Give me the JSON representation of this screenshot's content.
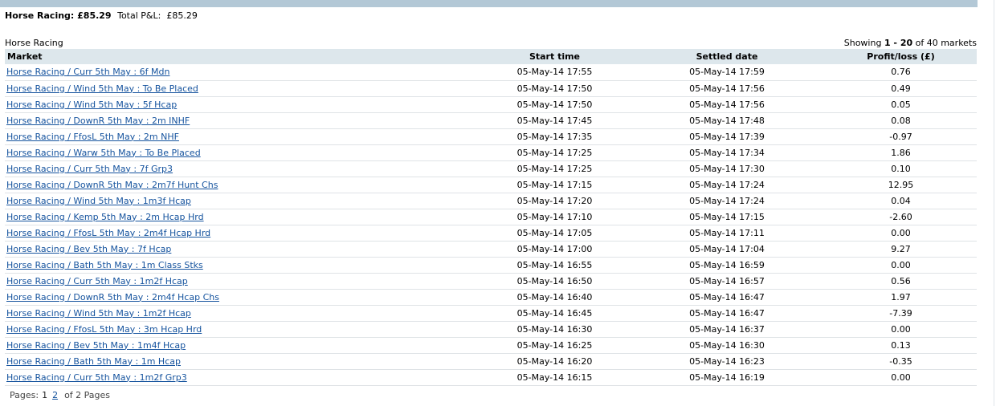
{
  "summary": {
    "category_total": "Horse Racing: £85.29",
    "total_label": "Total P&L:",
    "total_value": "£85.29"
  },
  "section_title": "Horse Racing",
  "showing": {
    "prefix": "Showing",
    "range": "1 - 20",
    "suffix": "of 40 markets"
  },
  "table": {
    "headers": {
      "market": "Market",
      "start": "Start time",
      "settled": "Settled date",
      "pl": "Profit/loss (£)"
    },
    "rows": [
      {
        "market": "Horse Racing / Curr 5th May : 6f Mdn",
        "start": "05-May-14 17:55",
        "settled": "05-May-14 17:59",
        "pl": "0.76"
      },
      {
        "market": "Horse Racing / Wind 5th May : To Be Placed",
        "start": "05-May-14 17:50",
        "settled": "05-May-14 17:56",
        "pl": "0.49"
      },
      {
        "market": "Horse Racing / Wind 5th May : 5f Hcap",
        "start": "05-May-14 17:50",
        "settled": "05-May-14 17:56",
        "pl": "0.05"
      },
      {
        "market": "Horse Racing / DownR 5th May : 2m INHF",
        "start": "05-May-14 17:45",
        "settled": "05-May-14 17:48",
        "pl": "0.08"
      },
      {
        "market": "Horse Racing / FfosL 5th May : 2m NHF",
        "start": "05-May-14 17:35",
        "settled": "05-May-14 17:39",
        "pl": "-0.97"
      },
      {
        "market": "Horse Racing / Warw 5th May : To Be Placed",
        "start": "05-May-14 17:25",
        "settled": "05-May-14 17:34",
        "pl": "1.86"
      },
      {
        "market": "Horse Racing / Curr 5th May : 7f Grp3",
        "start": "05-May-14 17:25",
        "settled": "05-May-14 17:30",
        "pl": "0.10"
      },
      {
        "market": "Horse Racing / DownR 5th May : 2m7f Hunt Chs",
        "start": "05-May-14 17:15",
        "settled": "05-May-14 17:24",
        "pl": "12.95"
      },
      {
        "market": "Horse Racing / Wind 5th May : 1m3f Hcap",
        "start": "05-May-14 17:20",
        "settled": "05-May-14 17:24",
        "pl": "0.04"
      },
      {
        "market": "Horse Racing / Kemp 5th May : 2m Hcap Hrd",
        "start": "05-May-14 17:10",
        "settled": "05-May-14 17:15",
        "pl": "-2.60"
      },
      {
        "market": "Horse Racing / FfosL 5th May : 2m4f Hcap Hrd",
        "start": "05-May-14 17:05",
        "settled": "05-May-14 17:11",
        "pl": "0.00"
      },
      {
        "market": "Horse Racing / Bev 5th May : 7f Hcap",
        "start": "05-May-14 17:00",
        "settled": "05-May-14 17:04",
        "pl": "9.27"
      },
      {
        "market": "Horse Racing / Bath 5th May : 1m Class Stks",
        "start": "05-May-14 16:55",
        "settled": "05-May-14 16:59",
        "pl": "0.00"
      },
      {
        "market": "Horse Racing / Curr 5th May : 1m2f Hcap",
        "start": "05-May-14 16:50",
        "settled": "05-May-14 16:57",
        "pl": "0.56"
      },
      {
        "market": "Horse Racing / DownR 5th May : 2m4f Hcap Chs",
        "start": "05-May-14 16:40",
        "settled": "05-May-14 16:47",
        "pl": "1.97"
      },
      {
        "market": "Horse Racing / Wind 5th May : 1m2f Hcap",
        "start": "05-May-14 16:45",
        "settled": "05-May-14 16:47",
        "pl": "-7.39"
      },
      {
        "market": "Horse Racing / FfosL 5th May : 3m Hcap Hrd",
        "start": "05-May-14 16:30",
        "settled": "05-May-14 16:37",
        "pl": "0.00"
      },
      {
        "market": "Horse Racing / Bev 5th May : 1m4f Hcap",
        "start": "05-May-14 16:25",
        "settled": "05-May-14 16:30",
        "pl": "0.13"
      },
      {
        "market": "Horse Racing / Bath 5th May : 1m Hcap",
        "start": "05-May-14 16:20",
        "settled": "05-May-14 16:23",
        "pl": "-0.35"
      },
      {
        "market": "Horse Racing / Curr 5th May : 1m2f Grp3",
        "start": "05-May-14 16:15",
        "settled": "05-May-14 16:19",
        "pl": "0.00"
      }
    ]
  },
  "pager": {
    "label": "Pages:",
    "current": "1",
    "next": "2",
    "total": "of 2 Pages"
  }
}
